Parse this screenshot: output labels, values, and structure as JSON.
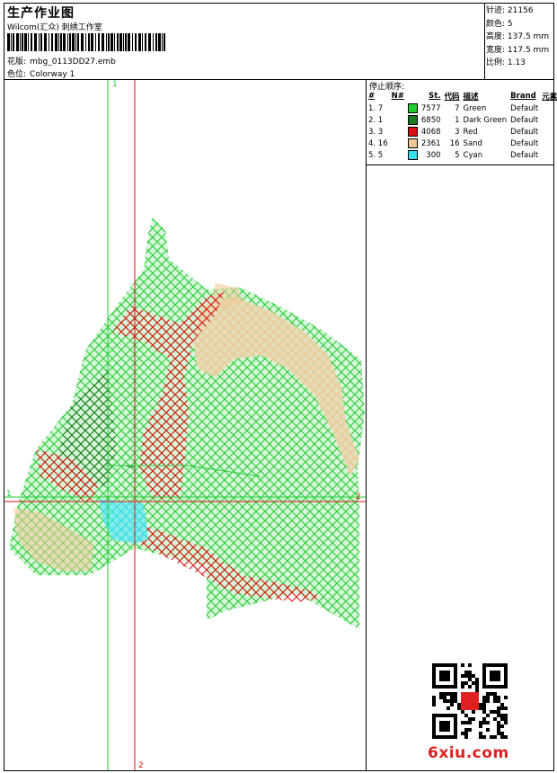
{
  "header": {
    "title": "生产作业图",
    "company": "Wilcom(汇众) 刺绣工作室",
    "design_label": "花版:",
    "design_value": "mbg_0113DD27.emb",
    "colorway_label": "色位:",
    "colorway_value": "Colorway 1"
  },
  "stats": [
    {
      "label": "针迹:",
      "value": "21156"
    },
    {
      "label": "颜色:",
      "value": "5"
    },
    {
      "label": "高度:",
      "value": "137.5 mm"
    },
    {
      "label": "宽度:",
      "value": "117.5 mm"
    },
    {
      "label": "比例:",
      "value": "1.13"
    }
  ],
  "stop_sequence": {
    "title": "停止顺序:",
    "columns": [
      "#",
      "N#",
      "St.",
      "代码",
      "描述",
      "Brand",
      "元素"
    ],
    "rows": [
      {
        "idx": "1. 7",
        "color": "#22cc33",
        "st": "7577",
        "code": "7",
        "desc": "Green",
        "brand": "Default"
      },
      {
        "idx": "2. 1",
        "color": "#1a7a22",
        "st": "6850",
        "code": "1",
        "desc": "Dark Green",
        "brand": "Default"
      },
      {
        "idx": "3. 3",
        "color": "#dd1111",
        "st": "4068",
        "code": "3",
        "desc": "Red",
        "brand": "Default"
      },
      {
        "idx": "4. 16",
        "color": "#f0c898",
        "st": "2361",
        "code": "16",
        "desc": "Sand",
        "brand": "Default"
      },
      {
        "idx": "5. 5",
        "color": "#33e0f0",
        "st": "300",
        "code": "5",
        "desc": "Cyan",
        "brand": "Default"
      }
    ]
  },
  "guides": {
    "v1_label": "1",
    "v2_label": "2",
    "h1_label": "1",
    "h2_label": "2"
  },
  "colors": {
    "green": "#22cc33",
    "dark_green": "#1a7a22",
    "red": "#dd1111",
    "sand": "#f0c898",
    "cyan": "#33e0f0",
    "logo": "#e02020"
  },
  "watermark": {
    "site": "6xiu.com"
  }
}
